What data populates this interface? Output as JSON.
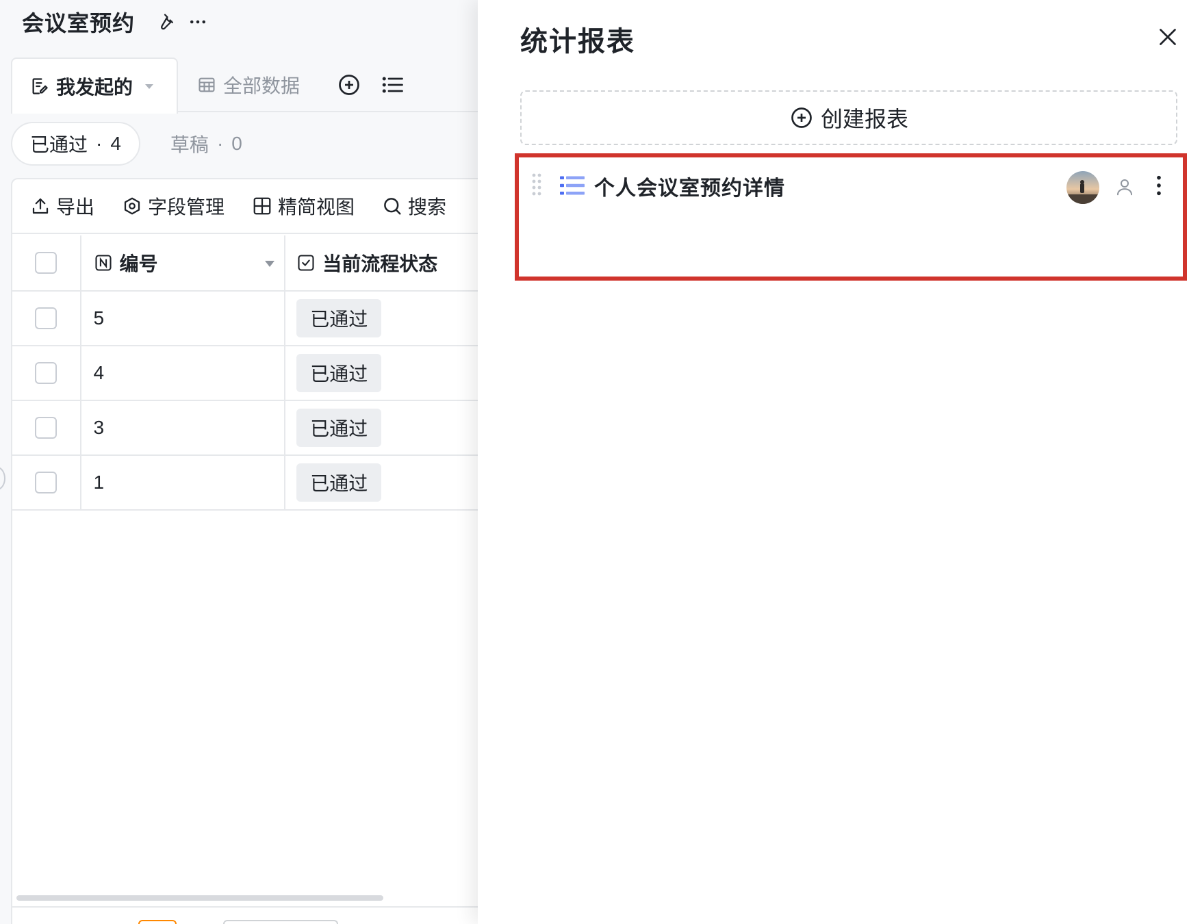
{
  "app": {
    "title": "会议室预约"
  },
  "tabs": {
    "mine_label": "我发起的",
    "all_label": "全部数据"
  },
  "filters": {
    "approved_label": "已通过",
    "approved_count": "4",
    "draft_label": "草稿",
    "draft_count": "0",
    "separator": "·"
  },
  "toolbar": {
    "export_label": "导出",
    "fields_label": "字段管理",
    "compact_label": "精简视图",
    "search_label": "搜索"
  },
  "table": {
    "columns": {
      "number": "编号",
      "status": "当前流程状态"
    },
    "rows": [
      {
        "number": "5",
        "status": "已通过"
      },
      {
        "number": "4",
        "status": "已通过"
      },
      {
        "number": "3",
        "status": "已通过"
      },
      {
        "number": "1",
        "status": "已通过"
      }
    ]
  },
  "panel": {
    "title": "统计报表",
    "create_label": "创建报表",
    "reports": [
      {
        "name": "个人会议室预约详情"
      }
    ]
  },
  "colors": {
    "highlight_border": "#d0342c",
    "accent_blue": "#4e6ef2",
    "pager_orange": "#ff8800"
  }
}
